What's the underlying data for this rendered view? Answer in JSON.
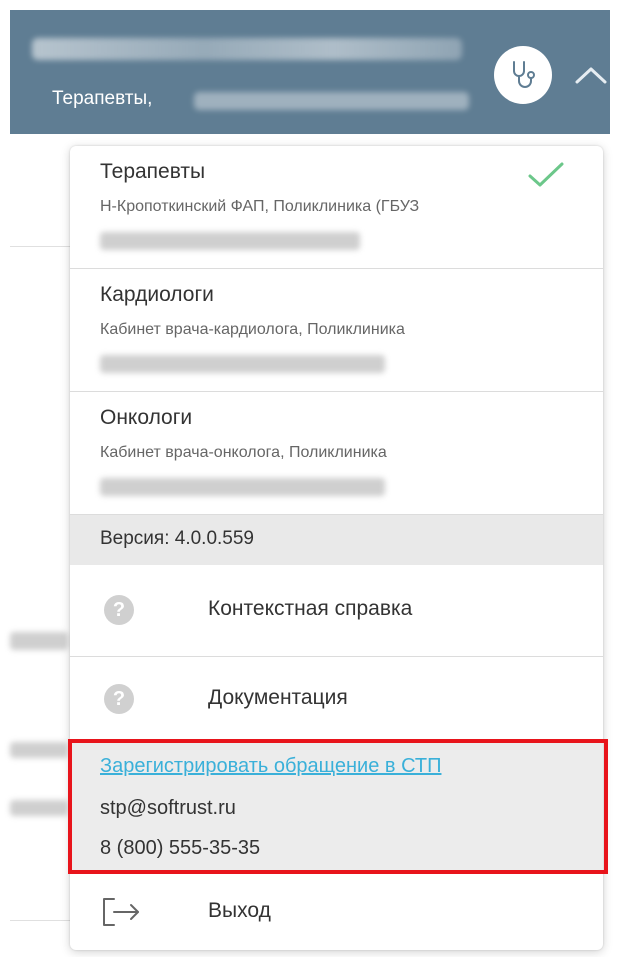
{
  "header": {
    "user_role": "Терапевты,",
    "avatar_icon": "stethoscope-icon",
    "toggle_icon": "chevron-up-icon"
  },
  "menu": {
    "roles": [
      {
        "title": "Терапевты",
        "description": "Н-Кропоткинский ФАП, Поликлиника (ГБУЗ",
        "selected": true
      },
      {
        "title": "Кардиологи",
        "description": "Кабинет врача-кардиолога, Поликлиника",
        "selected": false
      },
      {
        "title": "Онкологи",
        "description": "Кабинет врача-онколога, Поликлиника",
        "selected": false
      }
    ],
    "version": "Версия: 4.0.0.559",
    "context_help": "Контекстная справка",
    "documentation": "Документация",
    "support": {
      "link": "Зарегистрировать обращение в СТП",
      "email": "stp@softrust.ru",
      "phone": "8 (800) 555-35-35"
    },
    "logout": "Выход"
  },
  "colors": {
    "header_bg": "#5f7d93",
    "check": "#6cc78a",
    "link": "#3ab0d9",
    "highlight": "#e8141b"
  }
}
